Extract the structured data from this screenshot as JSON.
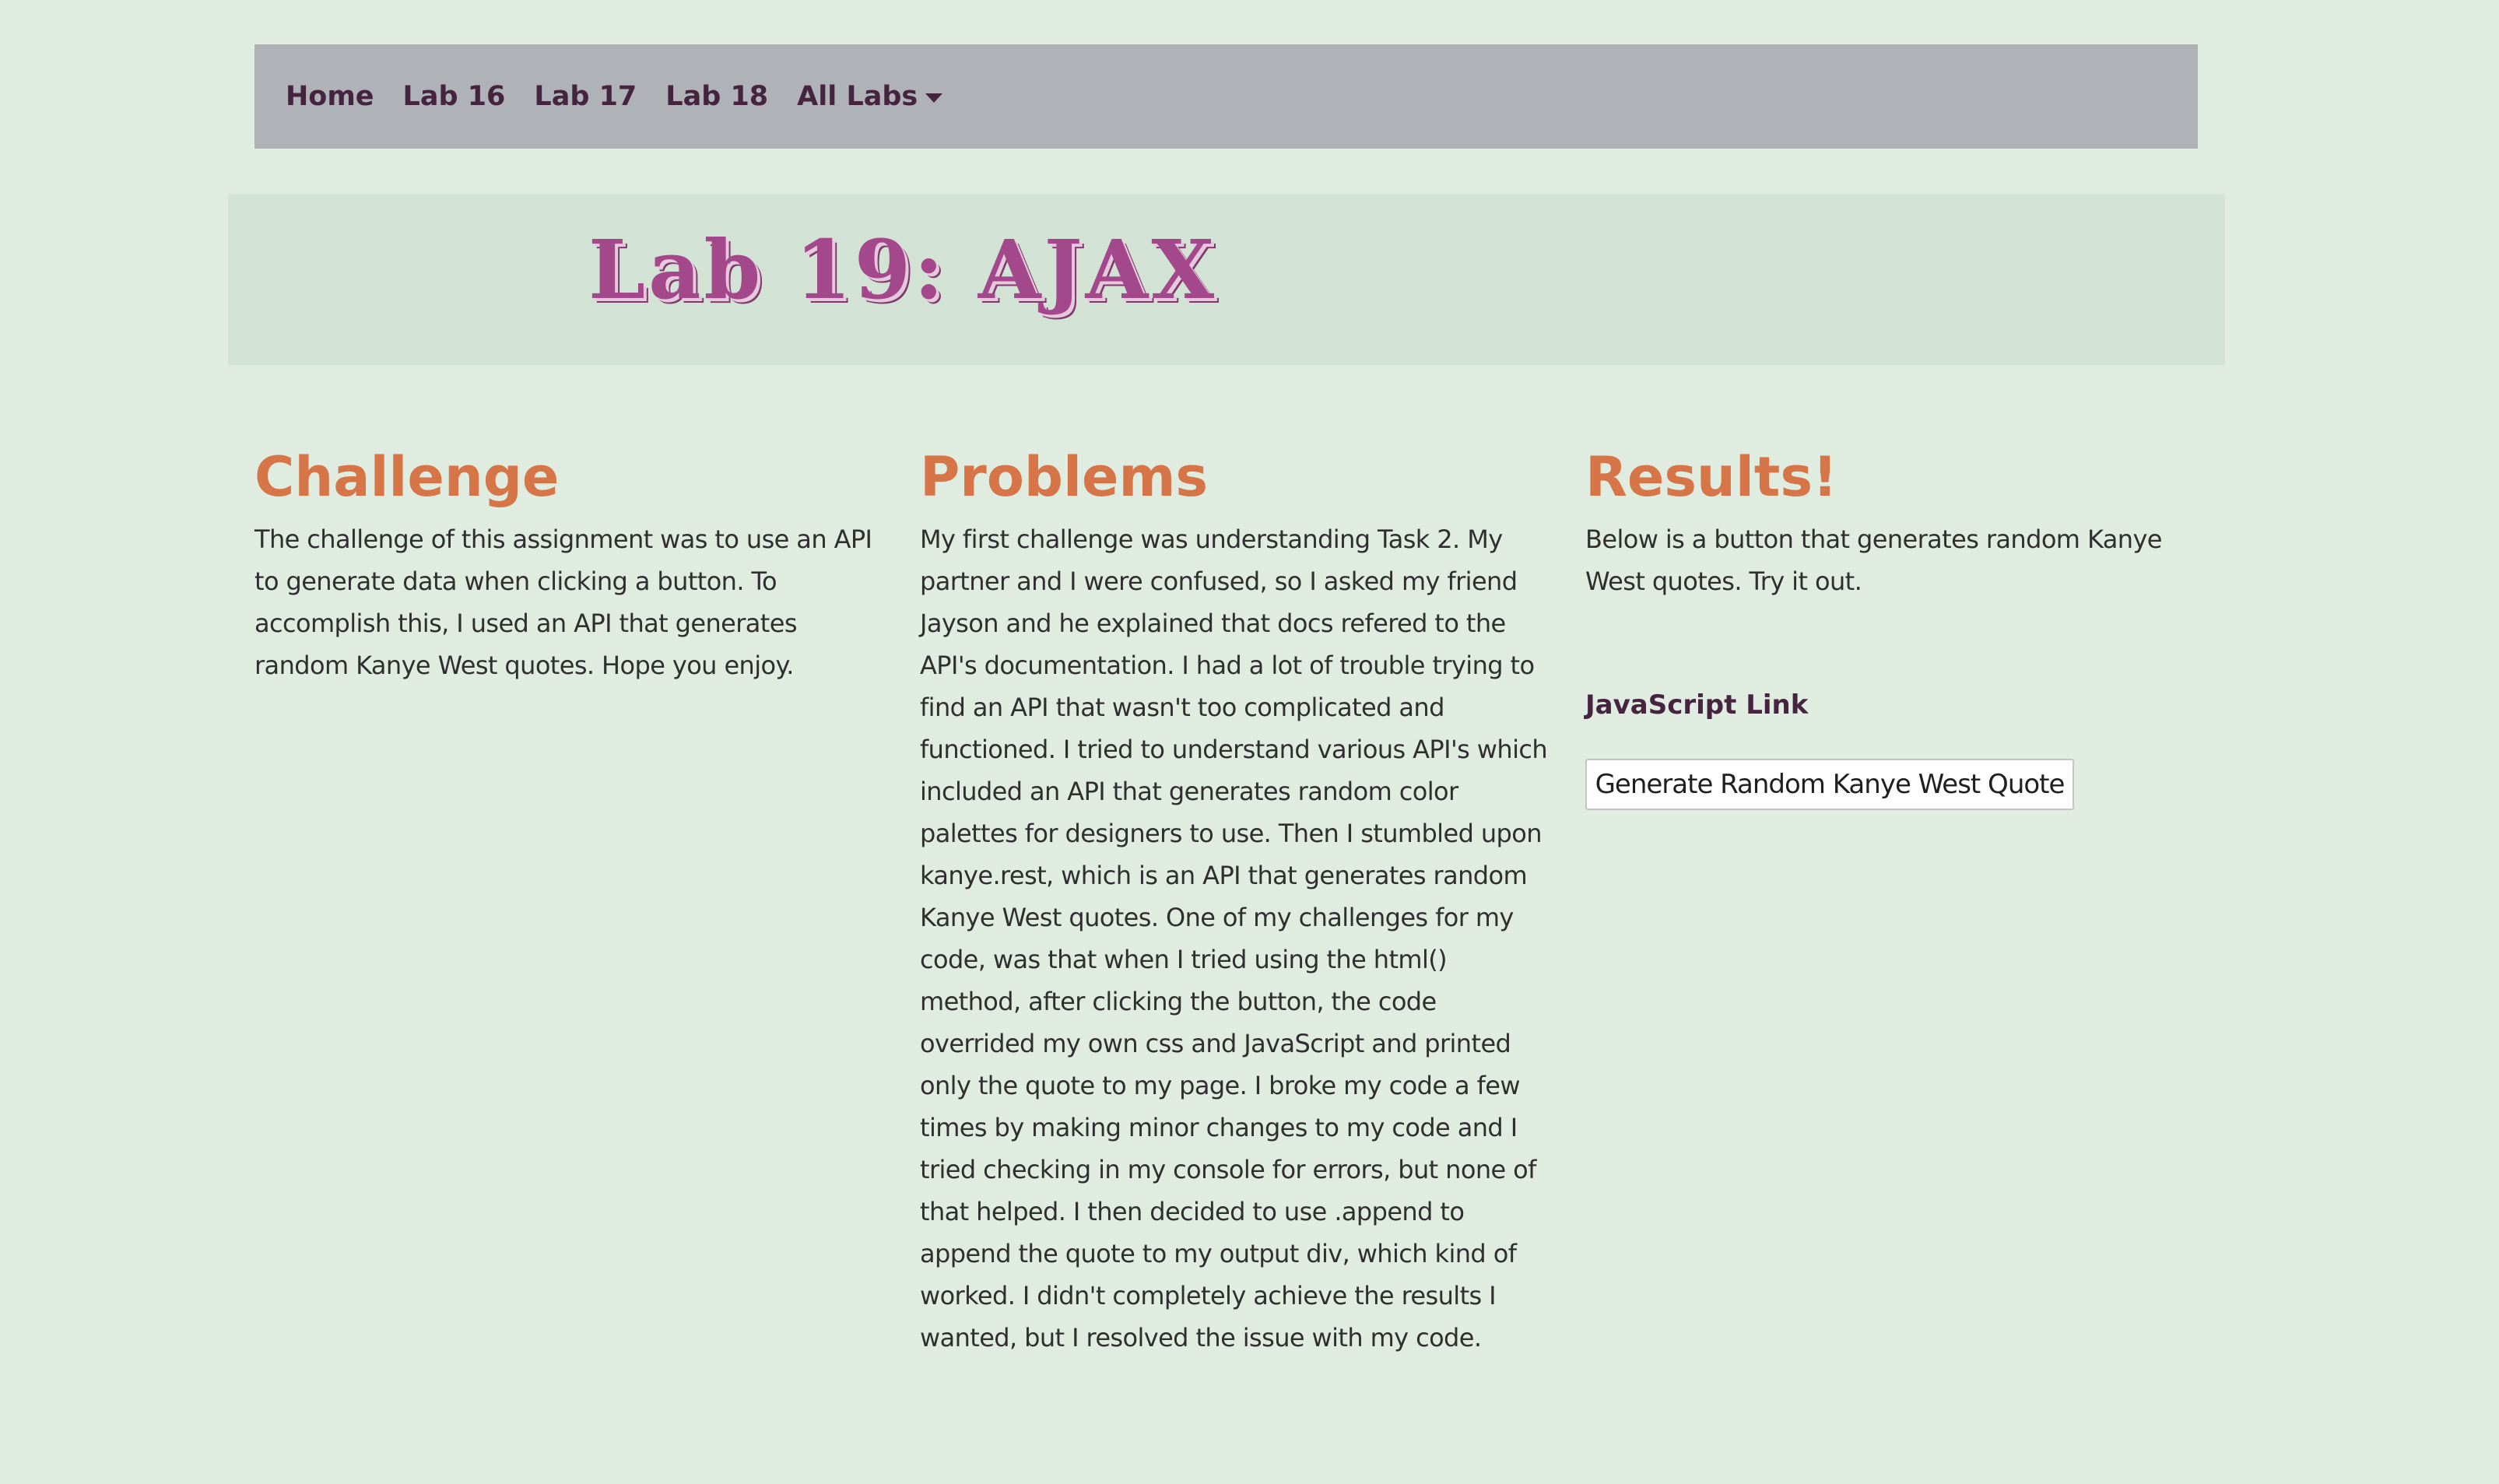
{
  "nav": {
    "items": [
      {
        "label": "Home"
      },
      {
        "label": "Lab 16"
      },
      {
        "label": "Lab 17"
      },
      {
        "label": "Lab 18"
      },
      {
        "label": "All Labs",
        "icon": "caret-down-icon"
      }
    ]
  },
  "header": {
    "title": "Lab 19: AJAX"
  },
  "sections": {
    "challenge": {
      "heading": "Challenge",
      "body": "The challenge of this assignment was to use an API to generate data when clicking a button. To accomplish this, I used an API that generates random Kanye West quotes. Hope you enjoy."
    },
    "problems": {
      "heading": "Problems",
      "body": "My first challenge was understanding Task 2. My partner and I were confused, so I asked my friend Jayson and he explained that docs refered to the API's documentation. I had a lot of trouble trying to find an API that wasn't too complicated and functioned. I tried to understand various API's which included an API that generates random color palettes for designers to use. Then I stumbled upon kanye.rest, which is an API that generates random Kanye West quotes. One of my challenges for my code, was that when I tried using the html() method, after clicking the button, the code overrided my own css and JavaScript and printed only the quote to my page. I broke my code a few times by making minor changes to my code and I tried checking in my console for errors, but none of that helped. I then decided to use .append to append the quote to my output div, which kind of worked. I didn't completely achieve the results I wanted, but I resolved the issue with my code."
    },
    "results": {
      "heading": "Results!",
      "body": "Below is a button that generates random Kanye West quotes. Try it out.",
      "link_label": "JavaScript Link",
      "button_label": "Generate Random Kanye West Quote"
    }
  },
  "colors": {
    "page_background": "#e1ece1",
    "navbar_background": "#afb3b8",
    "nav_text": "#45243f",
    "jumbotron_background": "#d2e2d5",
    "title": "#a2488b",
    "heading": "#d57548",
    "body_text": "#2f2f2f"
  }
}
